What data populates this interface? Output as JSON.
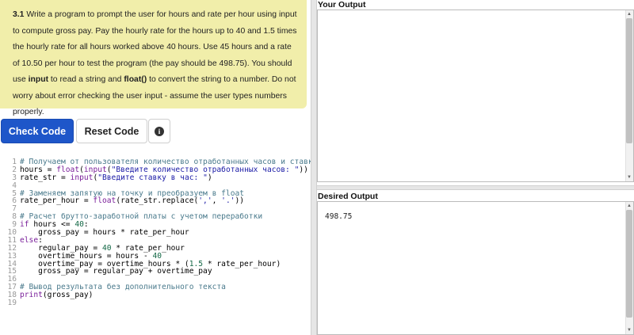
{
  "instructions": {
    "number": "3.1",
    "text_1": " Write a program to prompt the user for hours and rate per hour using input to compute gross pay. Pay the hourly rate for the hours up to 40 and 1.5 times the hourly rate for all hours worked above 40 hours. Use 45 hours and a rate of 10.50 per hour to test the program (the pay should be 498.75). You should use ",
    "kw_input": "input",
    "text_2": " to read a string and ",
    "kw_float": "float()",
    "text_3": " to convert the string to a number. Do not worry about error checking the user input - assume the user types numbers properly."
  },
  "toolbar": {
    "check_label": "Check Code",
    "reset_label": "Reset Code",
    "info_glyph": "i"
  },
  "editor": {
    "lines": [
      {
        "n": "1",
        "code": "# Получаем от пользователя количество отработанных часов и ставку"
      },
      {
        "n": "2",
        "code": "hours = float(input(\"Введите количество отработанных часов: \"))"
      },
      {
        "n": "3",
        "code": "rate_str = input(\"Введите ставку в час: \")"
      },
      {
        "n": "4",
        "code": ""
      },
      {
        "n": "5",
        "code": "# Заменяем запятую на точку и преобразуем в float"
      },
      {
        "n": "6",
        "code": "rate_per_hour = float(rate_str.replace(',', '.'))"
      },
      {
        "n": "7",
        "code": ""
      },
      {
        "n": "8",
        "code": "# Расчет брутто-заработной платы с учетом переработки"
      },
      {
        "n": "9",
        "code": "if hours <= 40:"
      },
      {
        "n": "10",
        "code": "    gross_pay = hours * rate_per_hour"
      },
      {
        "n": "11",
        "code": "else:"
      },
      {
        "n": "12",
        "code": "    regular_pay = 40 * rate_per_hour"
      },
      {
        "n": "13",
        "code": "    overtime_hours = hours - 40"
      },
      {
        "n": "14",
        "code": "    overtime_pay = overtime_hours * (1.5 * rate_per_hour)"
      },
      {
        "n": "15",
        "code": "    gross_pay = regular_pay + overtime_pay"
      },
      {
        "n": "16",
        "code": ""
      },
      {
        "n": "17",
        "code": "# Вывод результата без дополнительного текста"
      },
      {
        "n": "18",
        "code": "print(gross_pay)"
      },
      {
        "n": "19",
        "code": ""
      }
    ]
  },
  "your_output": {
    "title": "Your Output",
    "value": ""
  },
  "desired_output": {
    "title": "Desired Output",
    "value": "498.75"
  },
  "colors": {
    "instructions_bg": "#f1eeaa",
    "check_button": "#1e56c9"
  }
}
